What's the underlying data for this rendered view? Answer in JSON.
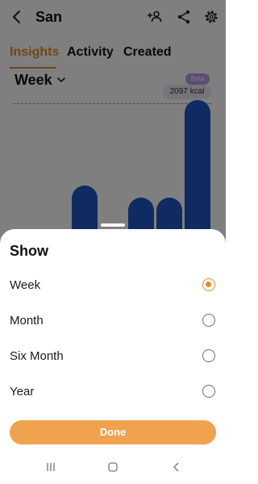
{
  "header": {
    "title": "San"
  },
  "icons": {
    "back": "back-arrow-icon",
    "add_person": "add-person-icon",
    "share": "share-icon",
    "settings": "gear-icon"
  },
  "tabs": [
    {
      "label": "Insights",
      "active": true
    },
    {
      "label": "Activity",
      "active": false
    },
    {
      "label": "Created",
      "active": false
    }
  ],
  "period": {
    "label": "Week"
  },
  "chart_data": {
    "type": "bar",
    "beta_label": "Beta",
    "goal_label": "2097 kcal",
    "series": [
      {
        "values": [
          0.0,
          0.36,
          0.0,
          0.27,
          0.27,
          1.0
        ]
      }
    ]
  },
  "sheet": {
    "title": "Show",
    "options": [
      {
        "label": "Week",
        "selected": true
      },
      {
        "label": "Month",
        "selected": false
      },
      {
        "label": "Six Month",
        "selected": false
      },
      {
        "label": "Year",
        "selected": false
      }
    ],
    "done_label": "Done"
  },
  "colors": {
    "accent": "#e48b2c",
    "done_button": "#f0a24f",
    "bar": "#1f56c2",
    "beta_badge": "#b59de6"
  },
  "system_nav": [
    "recent-apps-icon",
    "home-icon",
    "back-icon"
  ]
}
